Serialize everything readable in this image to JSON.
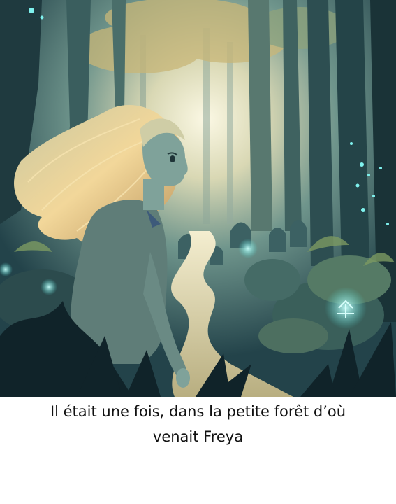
{
  "caption": {
    "line1": "Il était une fois, dans la petite forêt d’où",
    "line2": "venait Freya"
  },
  "illustration": {
    "subject": "storybook-forest-scene",
    "colors": {
      "sky_glow": "#f3efd2",
      "forest_dark": "#1f3a3f",
      "forest_mid": "#4a7672",
      "canopy_gold": "#c9b778",
      "path": "#e6dcb0",
      "hair": "#e9cf8f",
      "skin": "#7fa29a",
      "sweater": "#5f7d78",
      "rune_glow": "#7ff2ee",
      "foreground_leaves": "#102329"
    }
  }
}
